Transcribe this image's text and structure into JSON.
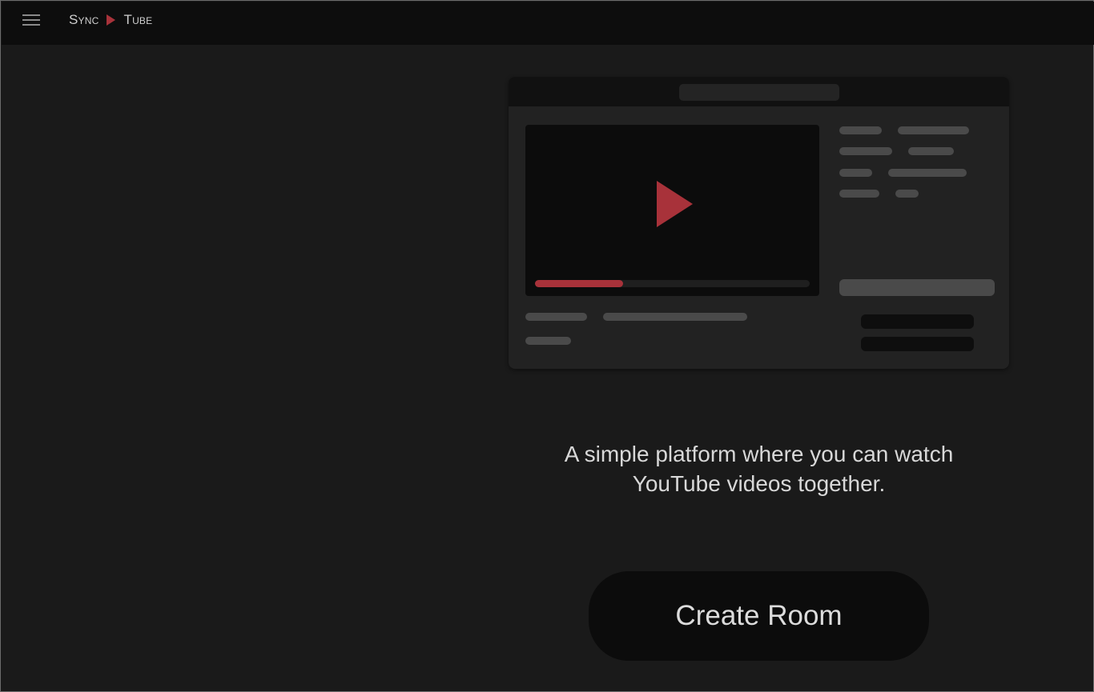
{
  "header": {
    "menu_icon": "hamburger-menu-icon",
    "logo_left": "Sync",
    "logo_right": "Tube",
    "logo_icon": "play-triangle-icon",
    "accent_color": "#a8323a"
  },
  "illustration": {
    "play_icon": "play-triangle-icon",
    "progress_fraction": 0.32
  },
  "main": {
    "tagline_line1": "A simple platform where you can watch",
    "tagline_line2": "YouTube videos together.",
    "create_button_label": "Create Room"
  }
}
